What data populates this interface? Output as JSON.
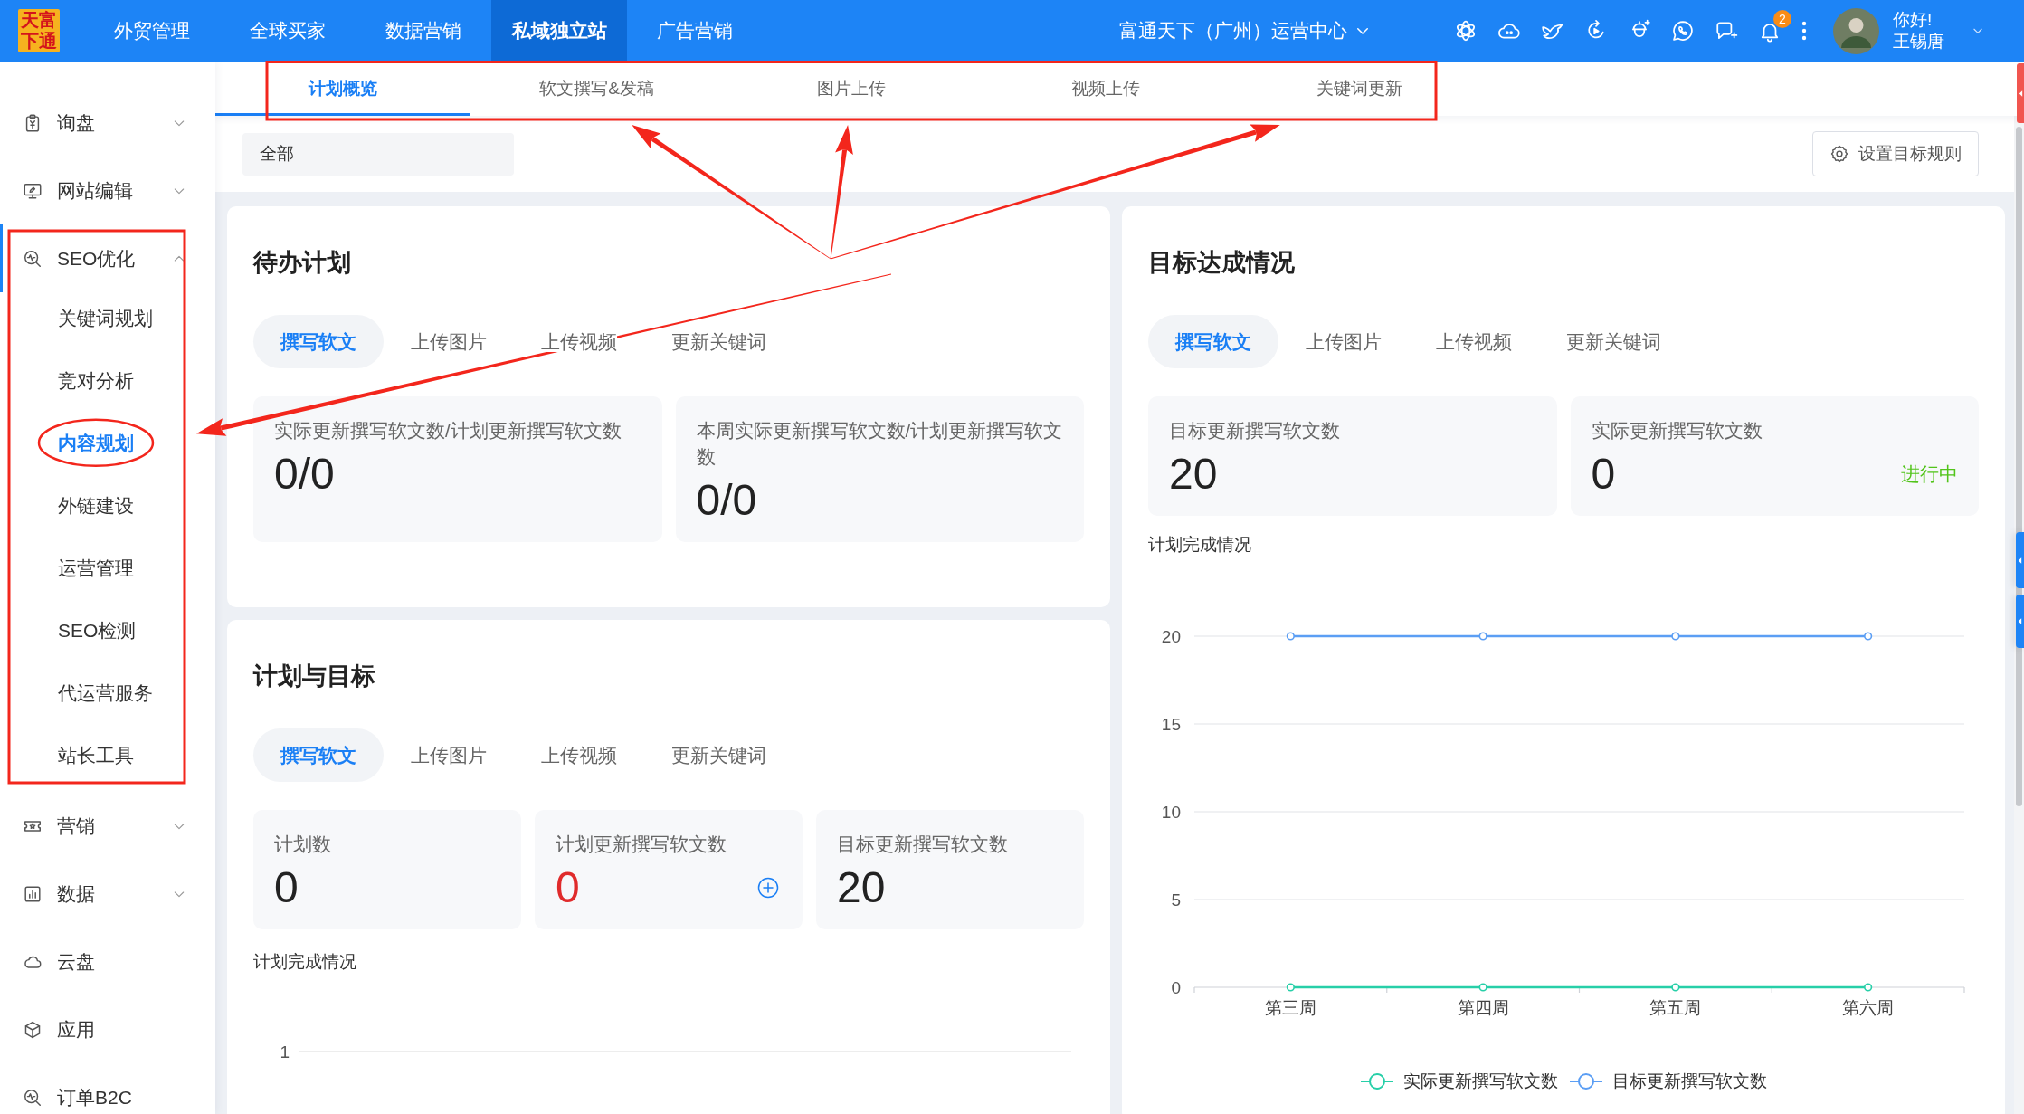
{
  "navbar": {
    "logo_text": "天富下通",
    "menu": [
      {
        "label": "外贸管理",
        "selected": false
      },
      {
        "label": "全球买家",
        "selected": false
      },
      {
        "label": "数据营销",
        "selected": false
      },
      {
        "label": "私域独立站",
        "selected": true
      },
      {
        "label": "广告营销",
        "selected": false
      }
    ],
    "org_selector": "富通天下（广州）运营中心",
    "notification_count": "2",
    "greeting": "你好!",
    "user_name": "王锡唐"
  },
  "sidebar": {
    "items": [
      {
        "kind": "group",
        "label": "询盘",
        "expanded": false,
        "framed": false
      },
      {
        "kind": "group",
        "label": "网站编辑",
        "expanded": false,
        "framed": false
      },
      {
        "kind": "group",
        "label": "SEO优化",
        "expanded": true,
        "framed": true,
        "children": [
          {
            "label": "关键词规划",
            "selected": false,
            "annotated": false
          },
          {
            "label": "竞对分析",
            "selected": false,
            "annotated": false
          },
          {
            "label": "内容规划",
            "selected": true,
            "annotated": true
          },
          {
            "label": "外链建设",
            "selected": false,
            "annotated": false
          },
          {
            "label": "运营管理",
            "selected": false,
            "annotated": false
          },
          {
            "label": "SEO检测",
            "selected": false,
            "annotated": false
          },
          {
            "label": "代运营服务",
            "selected": false,
            "annotated": false
          },
          {
            "label": "站长工具",
            "selected": false,
            "annotated": false
          }
        ]
      },
      {
        "kind": "group",
        "label": "营销",
        "expanded": false,
        "framed": false
      },
      {
        "kind": "group",
        "label": "数据",
        "expanded": false,
        "framed": false
      },
      {
        "kind": "link",
        "label": "云盘",
        "framed": false
      },
      {
        "kind": "link",
        "label": "应用",
        "framed": false
      },
      {
        "kind": "link",
        "label": "订单B2C",
        "framed": false
      }
    ]
  },
  "sub_tabs": {
    "framed": true,
    "items": [
      {
        "label": "计划概览",
        "selected": true,
        "arrow": false
      },
      {
        "label": "软文撰写&发稿",
        "selected": false,
        "arrow": true
      },
      {
        "label": "图片上传",
        "selected": false,
        "arrow": true
      },
      {
        "label": "视频上传",
        "selected": false,
        "arrow": false
      },
      {
        "label": "关键词更新",
        "selected": false,
        "arrow": true
      }
    ]
  },
  "filter": {
    "value": "全部"
  },
  "target_rule_button": "设置目标规则",
  "todo_card": {
    "title": "待办计划",
    "tabs": [
      {
        "label": "撰写软文",
        "selected": true
      },
      {
        "label": "上传图片",
        "selected": false
      },
      {
        "label": "上传视频",
        "selected": false
      },
      {
        "label": "更新关键词",
        "selected": false
      }
    ],
    "stats": [
      {
        "label": "实际更新撰写软文数/计划更新撰写软文数",
        "value": "0/0"
      },
      {
        "label": "本周实际更新撰写软文数/计划更新撰写软文数",
        "value": "0/0"
      }
    ]
  },
  "plan_card": {
    "title": "计划与目标",
    "tabs": [
      {
        "label": "撰写软文",
        "selected": true
      },
      {
        "label": "上传图片",
        "selected": false
      },
      {
        "label": "上传视频",
        "selected": false
      },
      {
        "label": "更新关键词",
        "selected": false
      }
    ],
    "stats": [
      {
        "label": "计划数",
        "value": "0",
        "alert": false,
        "addable": false
      },
      {
        "label": "计划更新撰写软文数",
        "value": "0",
        "alert": true,
        "addable": true
      },
      {
        "label": "目标更新撰写软文数",
        "value": "20",
        "alert": false,
        "addable": false
      }
    ],
    "chart": {
      "title": "计划完成情况",
      "tick_label": "1"
    }
  },
  "goal_card": {
    "title": "目标达成情况",
    "tabs": [
      {
        "label": "撰写软文",
        "selected": true
      },
      {
        "label": "上传图片",
        "selected": false
      },
      {
        "label": "上传视频",
        "selected": false
      },
      {
        "label": "更新关键词",
        "selected": false
      }
    ],
    "stats": [
      {
        "label": "目标更新撰写软文数",
        "value": "20"
      },
      {
        "label": "实际更新撰写软文数",
        "value": "0",
        "status": "进行中"
      }
    ],
    "chart_data": {
      "type": "line",
      "title": "计划完成情况",
      "categories": [
        "第三周",
        "第四周",
        "第五周",
        "第六周"
      ],
      "series": [
        {
          "name": "实际更新撰写软文数",
          "color": "#27cfa8",
          "marker": true,
          "values": [
            0,
            0,
            0,
            0
          ]
        },
        {
          "name": "目标更新撰写软文数",
          "color": "#5b9ef4",
          "marker": true,
          "values": [
            20,
            20,
            20,
            20
          ]
        }
      ],
      "ylim": [
        0,
        20
      ],
      "yticks": [
        0,
        5,
        10,
        15,
        20
      ],
      "grid": true
    }
  }
}
